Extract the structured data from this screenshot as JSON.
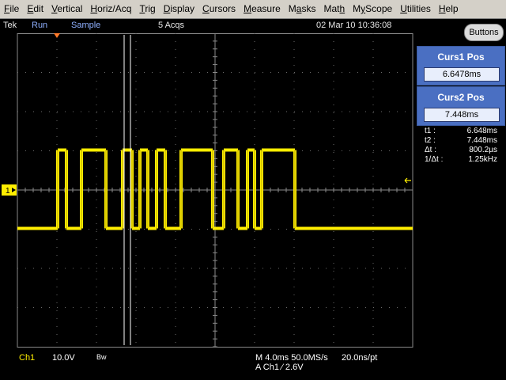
{
  "menu": [
    {
      "label": "File",
      "u": "F",
      "rest": "ile"
    },
    {
      "label": "Edit",
      "u": "E",
      "rest": "dit"
    },
    {
      "label": "Vertical",
      "u": "V",
      "rest": "ertical"
    },
    {
      "label": "Horiz/Acq",
      "u": "H",
      "rest": "oriz/Acq"
    },
    {
      "label": "Trig",
      "u": "T",
      "rest": "rig"
    },
    {
      "label": "Display",
      "u": "D",
      "rest": "isplay"
    },
    {
      "label": "Cursors",
      "u": "C",
      "rest": "ursors"
    },
    {
      "label": "Measure",
      "u": "M",
      "rest": "easure"
    },
    {
      "label": "Masks",
      "u": "a",
      "pre": "M",
      "rest": "sks"
    },
    {
      "label": "Math",
      "u": "h",
      "pre": "Mat",
      "rest": ""
    },
    {
      "label": "MyScope",
      "u": "y",
      "pre": "M",
      "rest": "Scope"
    },
    {
      "label": "Utilities",
      "u": "U",
      "rest": "tilities"
    },
    {
      "label": "Help",
      "u": "H",
      "rest": "elp"
    }
  ],
  "status": {
    "brand": "Tek",
    "run_state": "Run",
    "acq_mode": "Sample",
    "acqs": "5 Acqs",
    "datetime": "02 Mar 10 10:36:08",
    "buttons_label": "Buttons"
  },
  "cursors": {
    "curs1_title": "Curs1 Pos",
    "curs1_value": "6.6478ms",
    "curs2_title": "Curs2 Pos",
    "curs2_value": "7.448ms",
    "readout": [
      {
        "label": "t1 :",
        "value": "6.648ms"
      },
      {
        "label": "t2 :",
        "value": "7.448ms"
      },
      {
        "label": "Δt :",
        "value": "800.2µs"
      },
      {
        "label": "1/Δt :",
        "value": "1.25kHz"
      }
    ]
  },
  "channel": {
    "marker": "1",
    "name": "Ch1",
    "scale": "10.0V",
    "bw": "Bw"
  },
  "timebase": {
    "line1": "M 4.0ms 50.0MS/s",
    "rate": "20.0ns/pt",
    "trigger": "A  Ch1  ⁄  2.6V"
  },
  "colors": {
    "trace": "#ffee00",
    "cursor": "#ffffff",
    "panel": "#4a6fc2",
    "menubar": "#d4d0c8"
  },
  "waveform": {
    "time_units": "divisions",
    "transitions": [
      0,
      "low",
      1.02,
      "high",
      1.24,
      "low",
      1.62,
      "high",
      2.24,
      "low",
      2.66,
      "high",
      2.9,
      "low",
      3.1,
      "high",
      3.3,
      "low",
      3.52,
      "high",
      3.74,
      "low",
      4.14,
      "high",
      4.94,
      "low",
      5.22,
      "high",
      5.58,
      "low",
      5.82,
      "high",
      6.0,
      "low",
      6.18,
      "high",
      7.02,
      "low",
      10.0,
      "end"
    ],
    "cursor1_div": 2.7,
    "cursor2_div": 2.86
  }
}
